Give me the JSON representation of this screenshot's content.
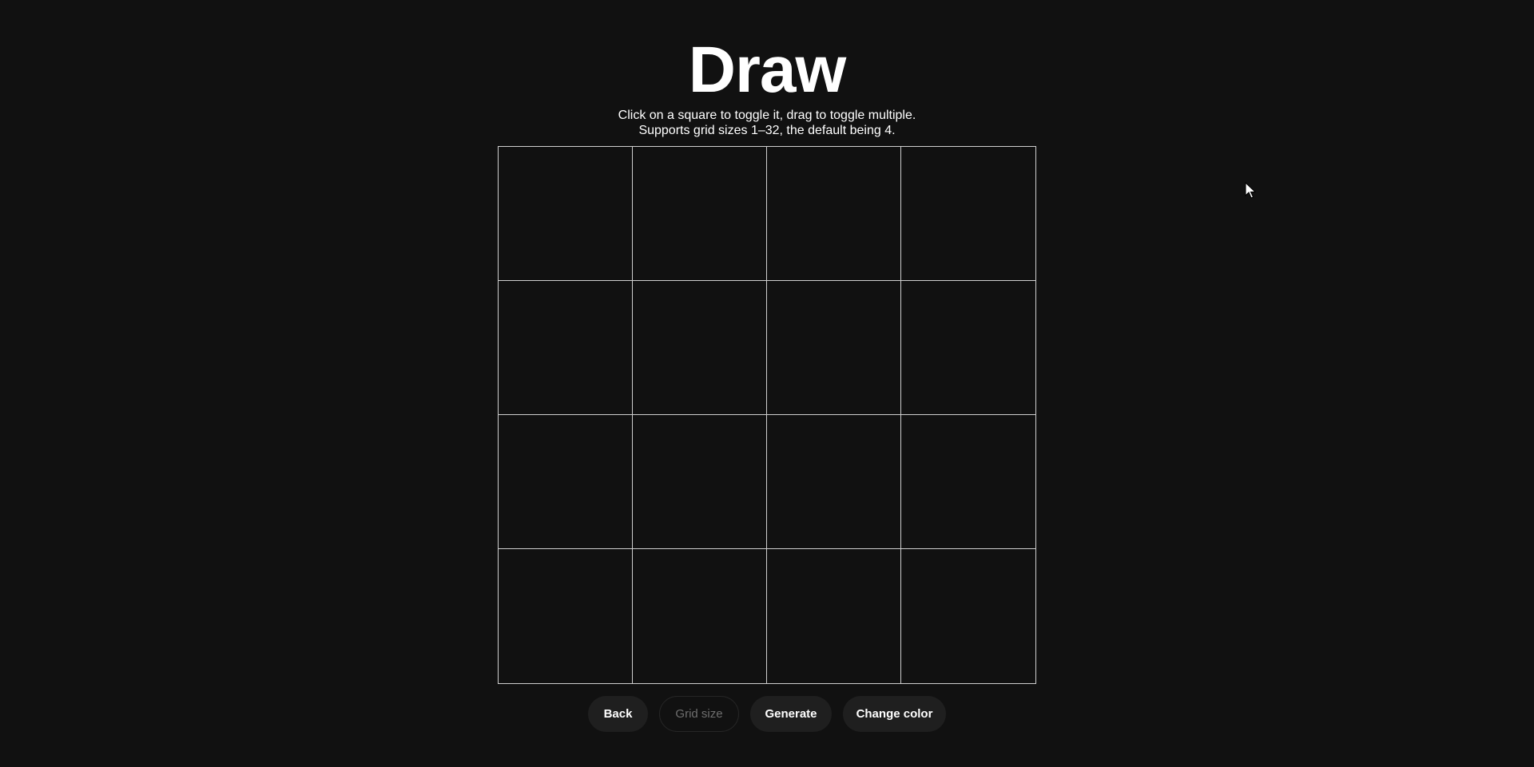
{
  "header": {
    "title": "Draw",
    "subtitle_line1": "Click on a square to toggle it, drag to toggle multiple.",
    "subtitle_line2": "Supports grid sizes 1–32, the default being 4."
  },
  "grid": {
    "size": 4,
    "line_color": "#cfcfcf",
    "cell_color": "#111111"
  },
  "controls": {
    "back_label": "Back",
    "grid_size_placeholder": "Grid size",
    "grid_size_value": "",
    "generate_label": "Generate",
    "change_color_label": "Change color"
  },
  "colors": {
    "background": "#111111",
    "button_bg": "#1f1f1f",
    "text": "#ffffff"
  },
  "icons": {
    "cursor": "mouse-pointer-icon"
  }
}
